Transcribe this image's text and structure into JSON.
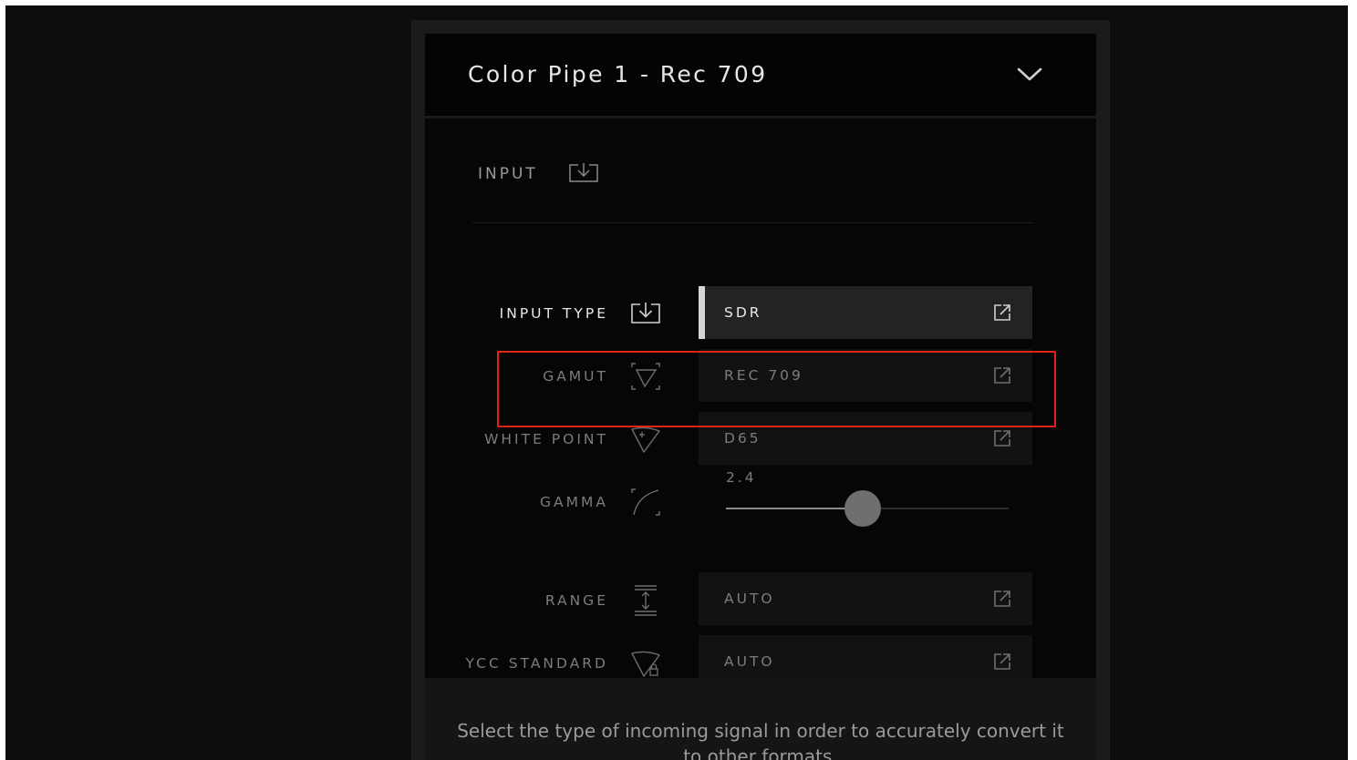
{
  "header": {
    "title": "Color Pipe 1 - Rec 709",
    "collapse_icon": "chevron-down-icon"
  },
  "section": {
    "title": "INPUT",
    "icon": "input-icon"
  },
  "rows": [
    {
      "key": "input_type",
      "label": "INPUT TYPE",
      "icon": "input-icon",
      "value": "SDR",
      "control": "select",
      "active": true
    },
    {
      "key": "gamut",
      "label": "GAMUT",
      "icon": "gamut-icon",
      "value": "REC 709",
      "control": "select"
    },
    {
      "key": "white_point",
      "label": "WHITE POINT",
      "icon": "white-point-icon",
      "value": "D65",
      "control": "select"
    },
    {
      "key": "gamma",
      "label": "GAMMA",
      "icon": "gamma-curve-icon",
      "value": "2.4",
      "control": "slider",
      "slider_fraction": 0.485
    },
    {
      "key": "range",
      "label": "RANGE",
      "icon": "range-icon",
      "value": "AUTO",
      "control": "select"
    },
    {
      "key": "ycc_standard",
      "label": "YCC STANDARD",
      "icon": "ycc-standard-icon",
      "value": "AUTO",
      "control": "select"
    }
  ],
  "select_icon": "external-link-icon",
  "description": "Select the type of incoming signal in order to accurately convert it to other formats.",
  "colors": {
    "highlight": "#e02418",
    "active_accent": "#d6d6d6",
    "background": "#0d0d0d"
  }
}
